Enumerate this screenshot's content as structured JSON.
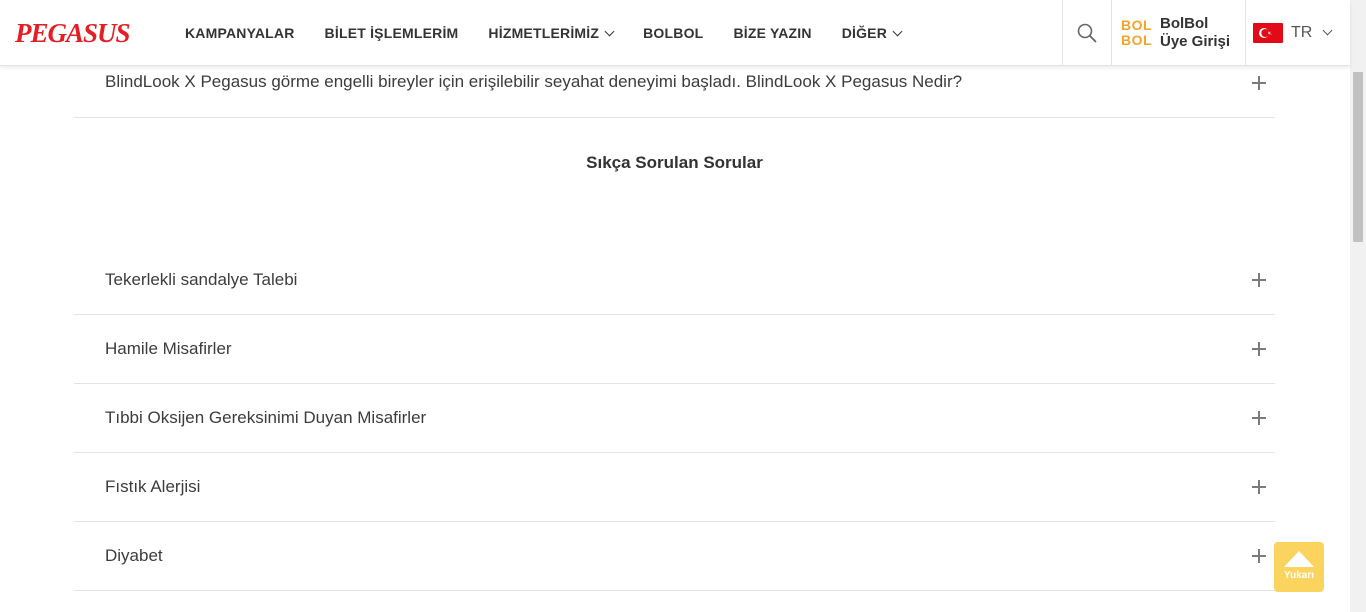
{
  "header": {
    "logo": "PEGASUS",
    "nav": [
      {
        "label": "KAMPANYALAR",
        "has_dropdown": false
      },
      {
        "label": "BİLET İŞLEMLERİM",
        "has_dropdown": false
      },
      {
        "label": "HİZMETLERİMİZ",
        "has_dropdown": true
      },
      {
        "label": "BOLBOL",
        "has_dropdown": false
      },
      {
        "label": "BİZE YAZIN",
        "has_dropdown": false
      },
      {
        "label": "DİĞER",
        "has_dropdown": true
      }
    ],
    "search_icon": "search-icon",
    "bolbol_logo_line1": "BOL",
    "bolbol_logo_line2": "BOL",
    "bolbol_line1": "BolBol",
    "bolbol_line2": "Üye Girişi",
    "language": "TR"
  },
  "content": {
    "top_item": "BlindLook X Pegasus görme engelli bireyler için erişilebilir seyahat deneyimi başladı. BlindLook X Pegasus Nedir?",
    "section_title": "Sıkça Sorulan Sorular",
    "faq_items": [
      "Tekerlekli sandalye Talebi",
      "Hamile Misafirler",
      "Tıbbi Oksijen Gereksinimi Duyan Misafirler",
      "Fıstık Alerjisi",
      "Diyabet"
    ]
  },
  "back_to_top": {
    "label": "Yukarı"
  },
  "colors": {
    "brand": "#e31e24",
    "bolbol": "#f2a52b",
    "top_button": "#fbd35f"
  }
}
